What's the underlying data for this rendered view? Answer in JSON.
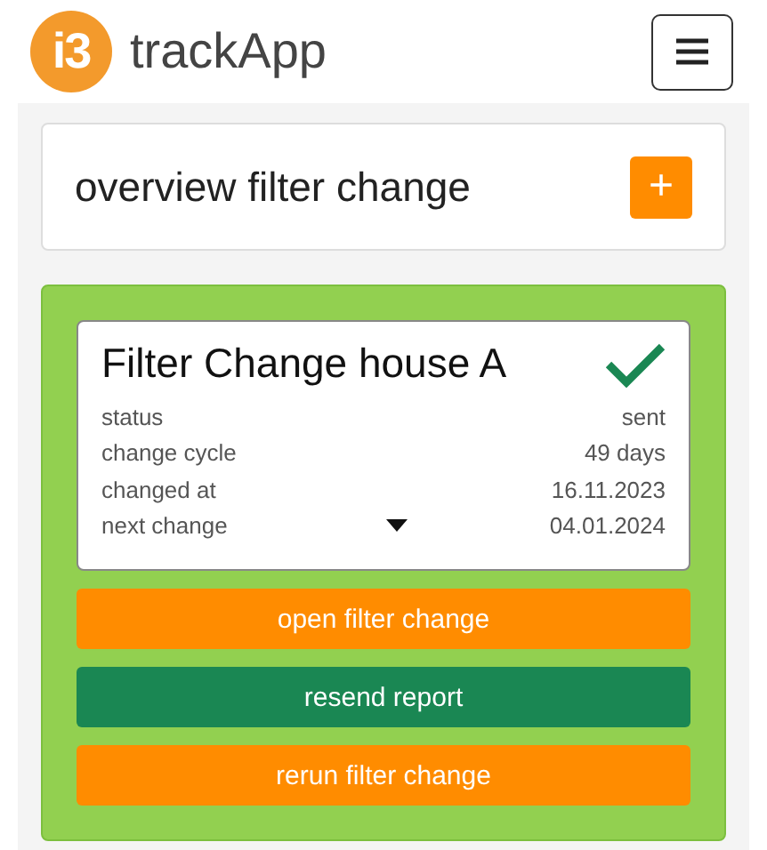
{
  "header": {
    "logo_text": "i3",
    "app_name": "trackApp"
  },
  "overview": {
    "title": "overview filter change",
    "add_button": "+"
  },
  "filter_card": {
    "title": "Filter Change house A",
    "done": true,
    "details": [
      {
        "label": "status",
        "value": "sent",
        "expandable": false
      },
      {
        "label": "change cycle",
        "value": "49 days",
        "expandable": false
      },
      {
        "label": "changed at",
        "value": "16.11.2023",
        "expandable": false
      },
      {
        "label": "next change",
        "value": "04.01.2024",
        "expandable": true
      }
    ],
    "buttons": [
      {
        "label": "open filter change",
        "kind": "warning"
      },
      {
        "label": "resend report",
        "kind": "success"
      },
      {
        "label": "rerun filter change",
        "kind": "warning"
      }
    ]
  }
}
